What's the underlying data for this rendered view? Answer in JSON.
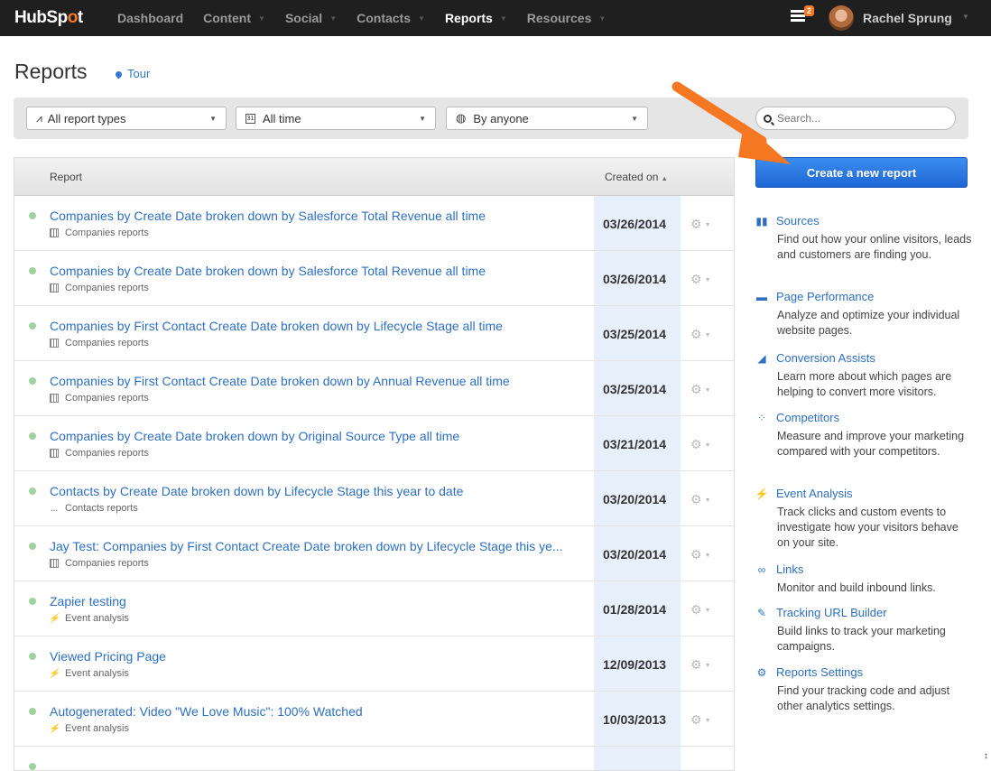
{
  "app": {
    "logo_text": "HubSp",
    "logo_dot": "o",
    "logo_tail": "t"
  },
  "nav": [
    {
      "label": "Dashboard",
      "caret": false,
      "active": false
    },
    {
      "label": "Content",
      "caret": true,
      "active": false
    },
    {
      "label": "Social",
      "caret": true,
      "active": false
    },
    {
      "label": "Contacts",
      "caret": true,
      "active": false
    },
    {
      "label": "Reports",
      "caret": true,
      "active": true
    },
    {
      "label": "Resources",
      "caret": true,
      "active": false
    }
  ],
  "header": {
    "notification_count": "2",
    "user_name": "Rachel Sprung"
  },
  "page": {
    "title": "Reports",
    "tour_label": "Tour"
  },
  "filters": {
    "type": "All report types",
    "time": "All time",
    "owner": "By anyone",
    "search_placeholder": "Search..."
  },
  "table": {
    "columns": {
      "report": "Report",
      "created": "Created on"
    },
    "rows": [
      {
        "title": "Companies by Create Date broken down by Salesforce Total Revenue all time",
        "category": "Companies reports",
        "cat_icon": "building-icon",
        "date": "03/26/2014"
      },
      {
        "title": "Companies by Create Date broken down by Salesforce Total Revenue all time",
        "category": "Companies reports",
        "cat_icon": "building-icon",
        "date": "03/26/2014"
      },
      {
        "title": "Companies by First Contact Create Date broken down by Lifecycle Stage all time",
        "category": "Companies reports",
        "cat_icon": "building-icon",
        "date": "03/25/2014"
      },
      {
        "title": "Companies by First Contact Create Date broken down by Annual Revenue all time",
        "category": "Companies reports",
        "cat_icon": "building-icon",
        "date": "03/25/2014"
      },
      {
        "title": "Companies by Create Date broken down by Original Source Type all time",
        "category": "Companies reports",
        "cat_icon": "building-icon",
        "date": "03/21/2014"
      },
      {
        "title": "Contacts by Create Date broken down by Lifecycle Stage this year to date",
        "category": "Contacts reports",
        "cat_icon": "people-icon",
        "date": "03/20/2014"
      },
      {
        "title": "Jay Test: Companies by First Contact Create Date broken down by Lifecycle Stage this ye...",
        "category": "Companies reports",
        "cat_icon": "building-icon",
        "date": "03/20/2014"
      },
      {
        "title": "Zapier testing",
        "category": "Event analysis",
        "cat_icon": "bolt-icon",
        "date": "01/28/2014"
      },
      {
        "title": "Viewed Pricing Page",
        "category": "Event analysis",
        "cat_icon": "bolt-icon",
        "date": "12/09/2013"
      },
      {
        "title": "Autogenerated: Video \"We Love Music\": 100% Watched",
        "category": "Event analysis",
        "cat_icon": "bolt-icon",
        "date": "10/03/2013"
      }
    ]
  },
  "sidebar": {
    "create_label": "Create a new report",
    "items": [
      {
        "label": "Sources",
        "desc": "Find out how your online visitors, leads and customers are finding you.",
        "icon": "bar-chart-icon"
      },
      {
        "label": "Page Performance",
        "desc": "Analyze and optimize your individual website pages.",
        "icon": "page-icon"
      },
      {
        "label": "Conversion Assists",
        "desc": "Learn more about which pages are helping to convert more visitors.",
        "icon": "growth-chart-icon"
      },
      {
        "label": "Competitors",
        "desc": "Measure and improve your marketing compared with your competitors.",
        "icon": "scatter-icon"
      },
      {
        "label": "Event Analysis",
        "desc": "Track clicks and custom events to investigate how your visitors behave on your site.",
        "icon": "bolt-icon"
      },
      {
        "label": "Links",
        "desc": "Monitor and build inbound links.",
        "icon": "link-icon"
      },
      {
        "label": "Tracking URL Builder",
        "desc": "Build links to track your marketing campaigns.",
        "icon": "pencil-icon"
      },
      {
        "label": "Reports Settings",
        "desc": "Find your tracking code and adjust other analytics settings.",
        "icon": "gear-icon"
      }
    ]
  },
  "colors": {
    "accent": "#2d6fc4",
    "brand_orange": "#f57722",
    "topbar": "#1f1f1f"
  }
}
